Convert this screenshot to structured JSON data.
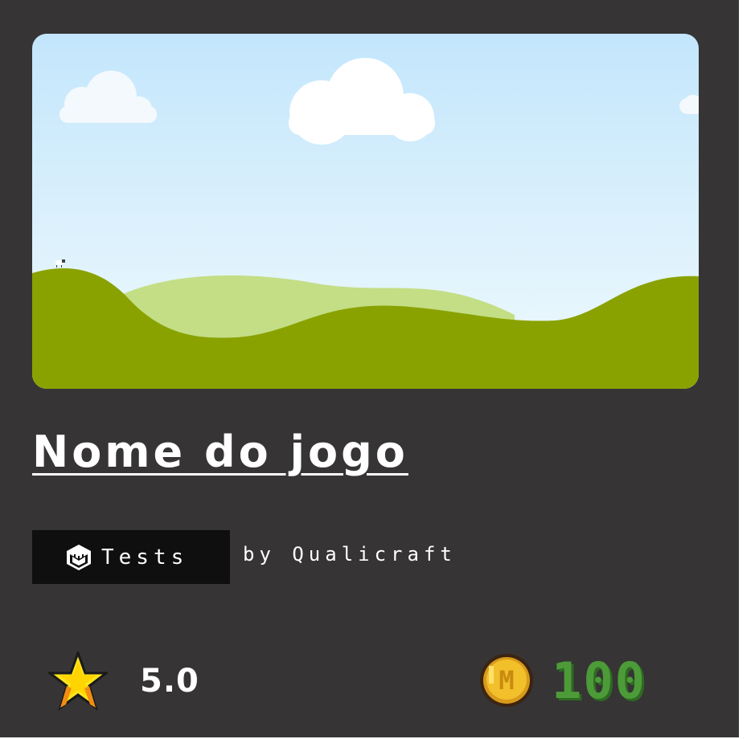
{
  "game": {
    "title": "Nome do jogo",
    "category": {
      "label": "Tests",
      "icon": "cube-icon"
    },
    "author_text": "by Qualicraft",
    "rating": "5.0",
    "rating_icon": "star-icon",
    "price": "100",
    "price_icon": "coin-icon",
    "coin_letter": "M"
  },
  "colors": {
    "card_background": "#363435",
    "tag_background": "#0f0f0f",
    "price_text": "#4c9b38",
    "sky_top": "#c3e6fc",
    "sky_bottom": "#ecf8fd",
    "hill_dark": "#8aa200",
    "hill_light": "#c3de85",
    "star": "#ffe51a",
    "coin": "#f2c02a"
  }
}
